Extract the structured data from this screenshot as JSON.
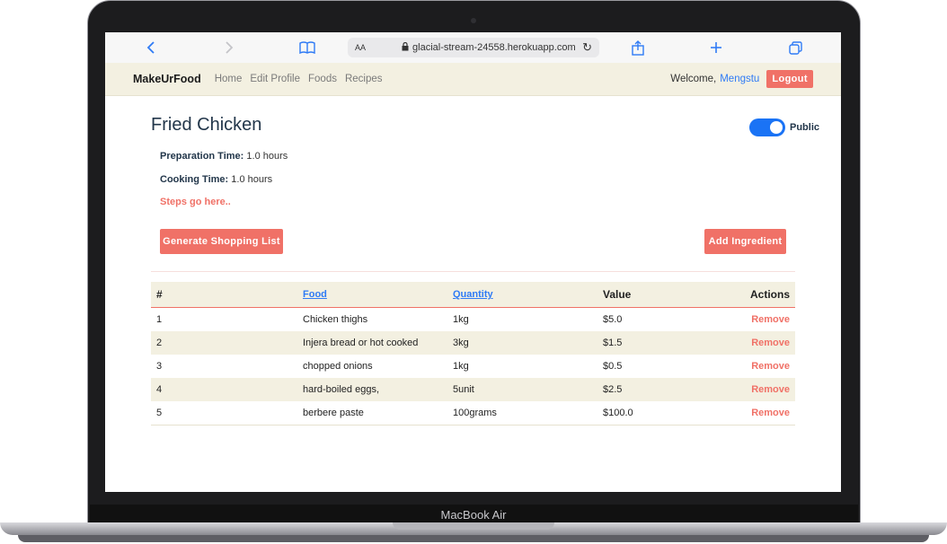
{
  "device": {
    "model_label": "MacBook Air"
  },
  "browser": {
    "url": "glacial-stream-24558.herokuapp.com",
    "text_size_label": "AA"
  },
  "navbar": {
    "brand": "MakeUrFood",
    "links": [
      "Home",
      "Edit Profile",
      "Foods",
      "Recipes"
    ],
    "welcome": "Welcome,",
    "user": "Mengstu",
    "logout": "Logout"
  },
  "recipe": {
    "title": "Fried Chicken",
    "public_label": "Public",
    "public_on": true,
    "prep_label": "Preparation Time:",
    "prep_value": "1.0 hours",
    "cook_label": "Cooking Time:",
    "cook_value": "1.0 hours",
    "steps": "Steps go here..",
    "generate_btn": "Generate Shopping List",
    "add_btn": "Add Ingredient"
  },
  "table": {
    "headers": {
      "num": "#",
      "food": "Food",
      "quantity": "Quantity",
      "value": "Value",
      "actions": "Actions"
    },
    "remove_label": "Remove",
    "rows": [
      {
        "num": "1",
        "food": "Chicken thighs",
        "quantity": "1kg",
        "value": "$5.0"
      },
      {
        "num": "2",
        "food": "Injera bread or hot cooked",
        "quantity": "3kg",
        "value": "$1.5"
      },
      {
        "num": "3",
        "food": "chopped onions",
        "quantity": "1kg",
        "value": "$0.5"
      },
      {
        "num": "4",
        "food": "hard-boiled eggs,",
        "quantity": "5unit",
        "value": "$2.5"
      },
      {
        "num": "5",
        "food": "berbere paste",
        "quantity": "100grams",
        "value": "$100.0"
      }
    ]
  },
  "colors": {
    "accent": "#f07167",
    "navbar_bg": "#f3f0e1",
    "link": "#2f7bf5",
    "toggle": "#1a73f5"
  }
}
